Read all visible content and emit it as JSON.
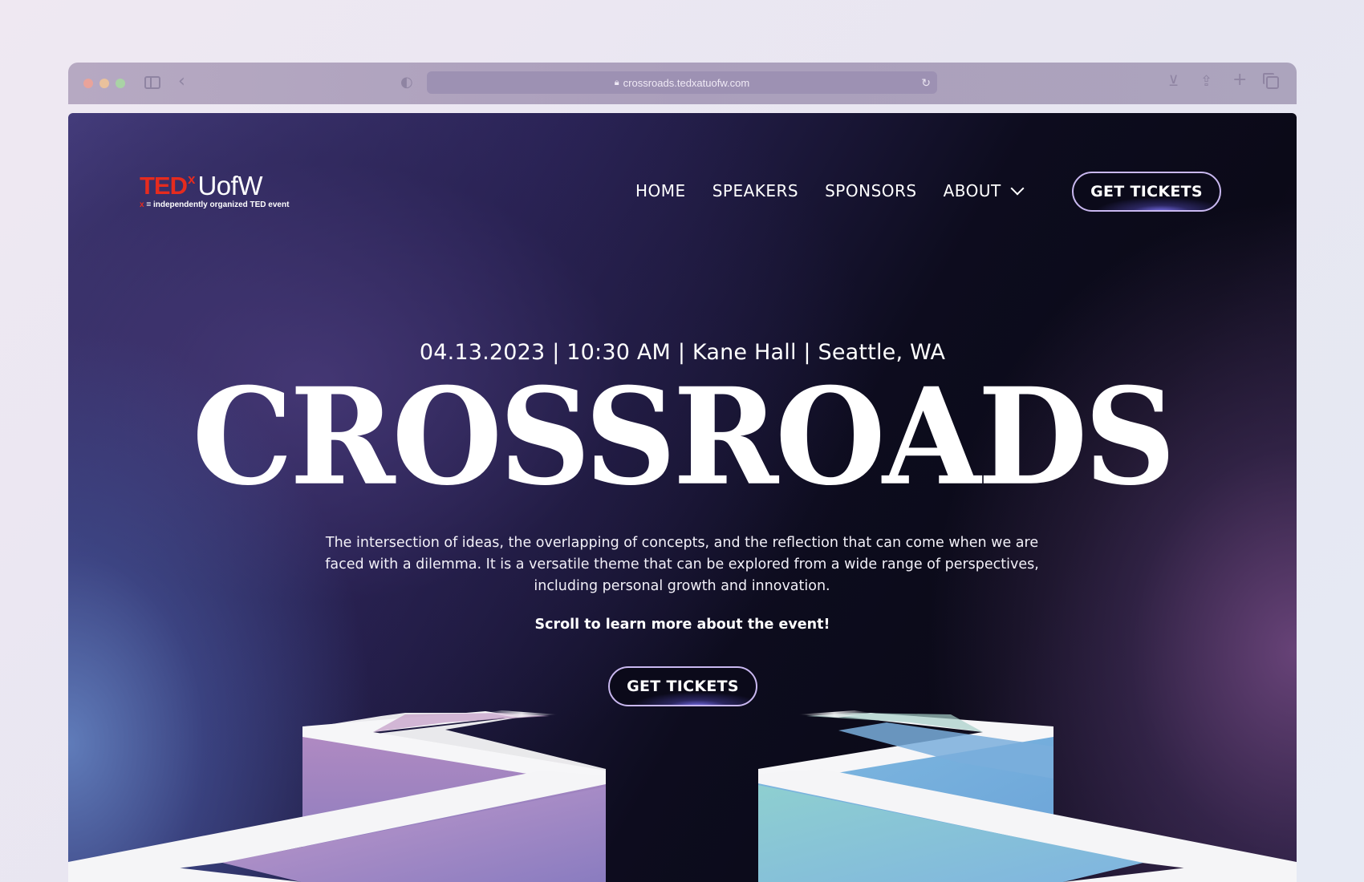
{
  "browser": {
    "url": "crossroads.tedxatuofw.com"
  },
  "logo": {
    "ted": "TED",
    "x": "x",
    "name": "UofW",
    "tagline_x": "x",
    "tagline": " = independently organized TED event"
  },
  "nav": {
    "items": [
      {
        "label": "HOME"
      },
      {
        "label": "SPEAKERS"
      },
      {
        "label": "SPONSORS"
      },
      {
        "label": "ABOUT"
      }
    ],
    "cta": "GET TICKETS"
  },
  "hero": {
    "event_info": "04.13.2023 | 10:30 AM | Kane Hall | Seattle, WA",
    "title": "CROSSROADS",
    "description": "The intersection of ideas, the overlapping of concepts, and the reflection that can come when we are faced with a dilemma. It is a versatile theme that can be explored from a wide range of perspectives, including personal growth and innovation.",
    "scroll_cta": "Scroll to learn more about the event!",
    "button": "GET TICKETS"
  },
  "colors": {
    "ted_red": "#e62b1e",
    "button_border": "#c9b8f0",
    "background_dark": "#0b0a18"
  }
}
